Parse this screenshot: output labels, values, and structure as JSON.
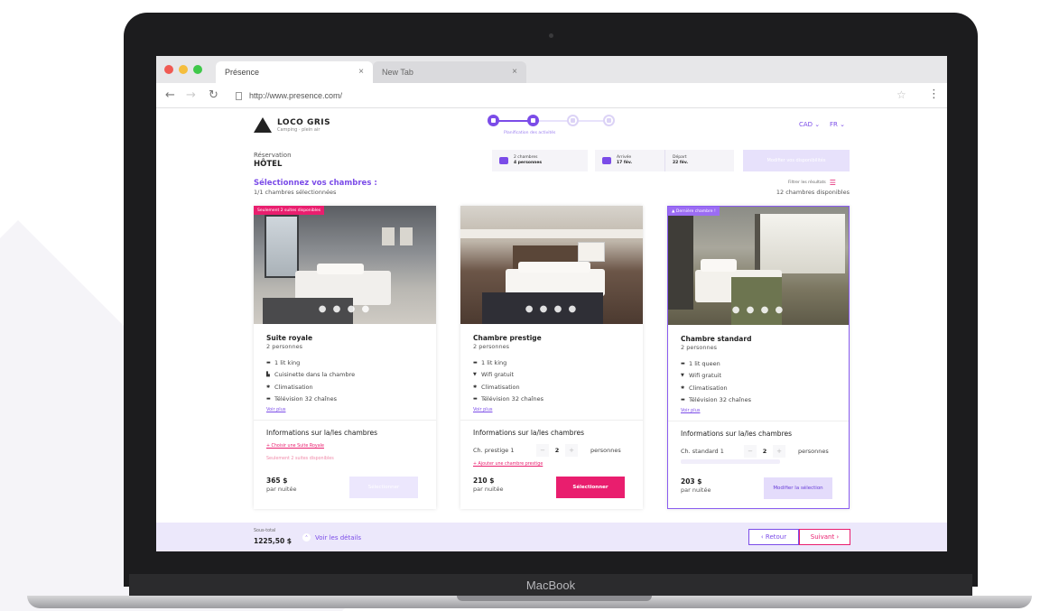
{
  "device": {
    "label": "MacBook"
  },
  "browser": {
    "tabs": [
      {
        "label": "Présence"
      },
      {
        "label": "New Tab"
      }
    ],
    "url": "http://www.presence.com/",
    "close_glyph": "×"
  },
  "header": {
    "logo_name": "LOCO GRIS",
    "logo_tagline": "Camping · plein air",
    "stepper": {
      "current_step_label": "Planification des activités",
      "steps_total": 4,
      "steps_completed": 2
    },
    "currency": "CAD ⌄",
    "language": "FR ⌄"
  },
  "reservation": {
    "label": "Réservation",
    "type": "HÔTEL",
    "rooms_line1": "2 chambres",
    "rooms_line2": "4 personnes",
    "arrival_label": "Arrivée",
    "arrival_date": "17 fév.",
    "departure_label": "Départ",
    "departure_date": "22 fév.",
    "modify_search": "Modifier vos disponibilités"
  },
  "selection": {
    "title": "Sélectionnez vos chambres :",
    "selected_count": "1/1 chambres sélectionnées",
    "filter_label": "Filtrer les résultats",
    "available_count": "12 chambres disponibles"
  },
  "rooms": [
    {
      "ribbon": "Seulement 2 suites disponibles",
      "name": "Suite royale",
      "persons": "2 personnes",
      "amenities": [
        {
          "icon": "bed-icon",
          "glyph": "▬",
          "label": "1 lit king"
        },
        {
          "icon": "kitchen-icon",
          "glyph": "▙",
          "label": "Cuisinette dans la chambre"
        },
        {
          "icon": "snowflake-icon",
          "glyph": "✱",
          "label": "Climatisation"
        },
        {
          "icon": "tv-icon",
          "glyph": "▬",
          "label": "Télévision 32 chaînes"
        }
      ],
      "see_more": "Voir plus",
      "info_title": "Informations sur la/les chambres",
      "choose_link": "+ Choisir une Suite Royale",
      "note": "Seulement 2 suites disponibles",
      "price": "365 $",
      "per_night": "par nuitée",
      "button": "Sélectionner",
      "carousel_dots": "● ● ● ●"
    },
    {
      "ribbon": "",
      "name": "Chambre prestige",
      "persons": "2 personnes",
      "amenities": [
        {
          "icon": "bed-icon",
          "glyph": "▬",
          "label": "1 lit king"
        },
        {
          "icon": "wifi-icon",
          "glyph": "▼",
          "label": "Wifi gratuit"
        },
        {
          "icon": "snowflake-icon",
          "glyph": "✱",
          "label": "Climatisation"
        },
        {
          "icon": "tv-icon",
          "glyph": "▬",
          "label": "Télévision 32 chaînes"
        }
      ],
      "see_more": "Voir plus",
      "info_title": "Informations sur la/les chambres",
      "room_select": "Ch. prestige 1",
      "quantity": "2",
      "persons_label": "personnes",
      "add_link": "+ Ajouter une chambre prestige",
      "price": "210 $",
      "per_night": "par nuitée",
      "button": "Sélectionner",
      "carousel_dots": "● ● ● ●"
    },
    {
      "ribbon": "▲ Dernière chambre !",
      "name": "Chambre standard",
      "persons": "2 personnes",
      "amenities": [
        {
          "icon": "bed-icon",
          "glyph": "▬",
          "label": "1 lit queen"
        },
        {
          "icon": "wifi-icon",
          "glyph": "▼",
          "label": "Wifi gratuit"
        },
        {
          "icon": "snowflake-icon",
          "glyph": "✱",
          "label": "Climatisation"
        },
        {
          "icon": "tv-icon",
          "glyph": "▬",
          "label": "Télévision 32 chaînes"
        }
      ],
      "see_more": "Voir plus",
      "info_title": "Informations sur la/les chambres",
      "room_select": "Ch. standard 1",
      "quantity": "2",
      "persons_label": "personnes",
      "price": "203 $",
      "per_night": "par nuitée",
      "button": "Modifier la sélection",
      "carousel_dots": "● ● ● ●"
    }
  ],
  "footer": {
    "subtotal_label": "Sous-total",
    "subtotal_value": "1225,50 $",
    "details_link": "Voir les détails",
    "back_button": "‹ Retour",
    "next_button": "Suivant ›"
  },
  "colors": {
    "accent": "#7b4ce8",
    "pink": "#e91e6e",
    "footer_bg": "#ece8fb"
  }
}
